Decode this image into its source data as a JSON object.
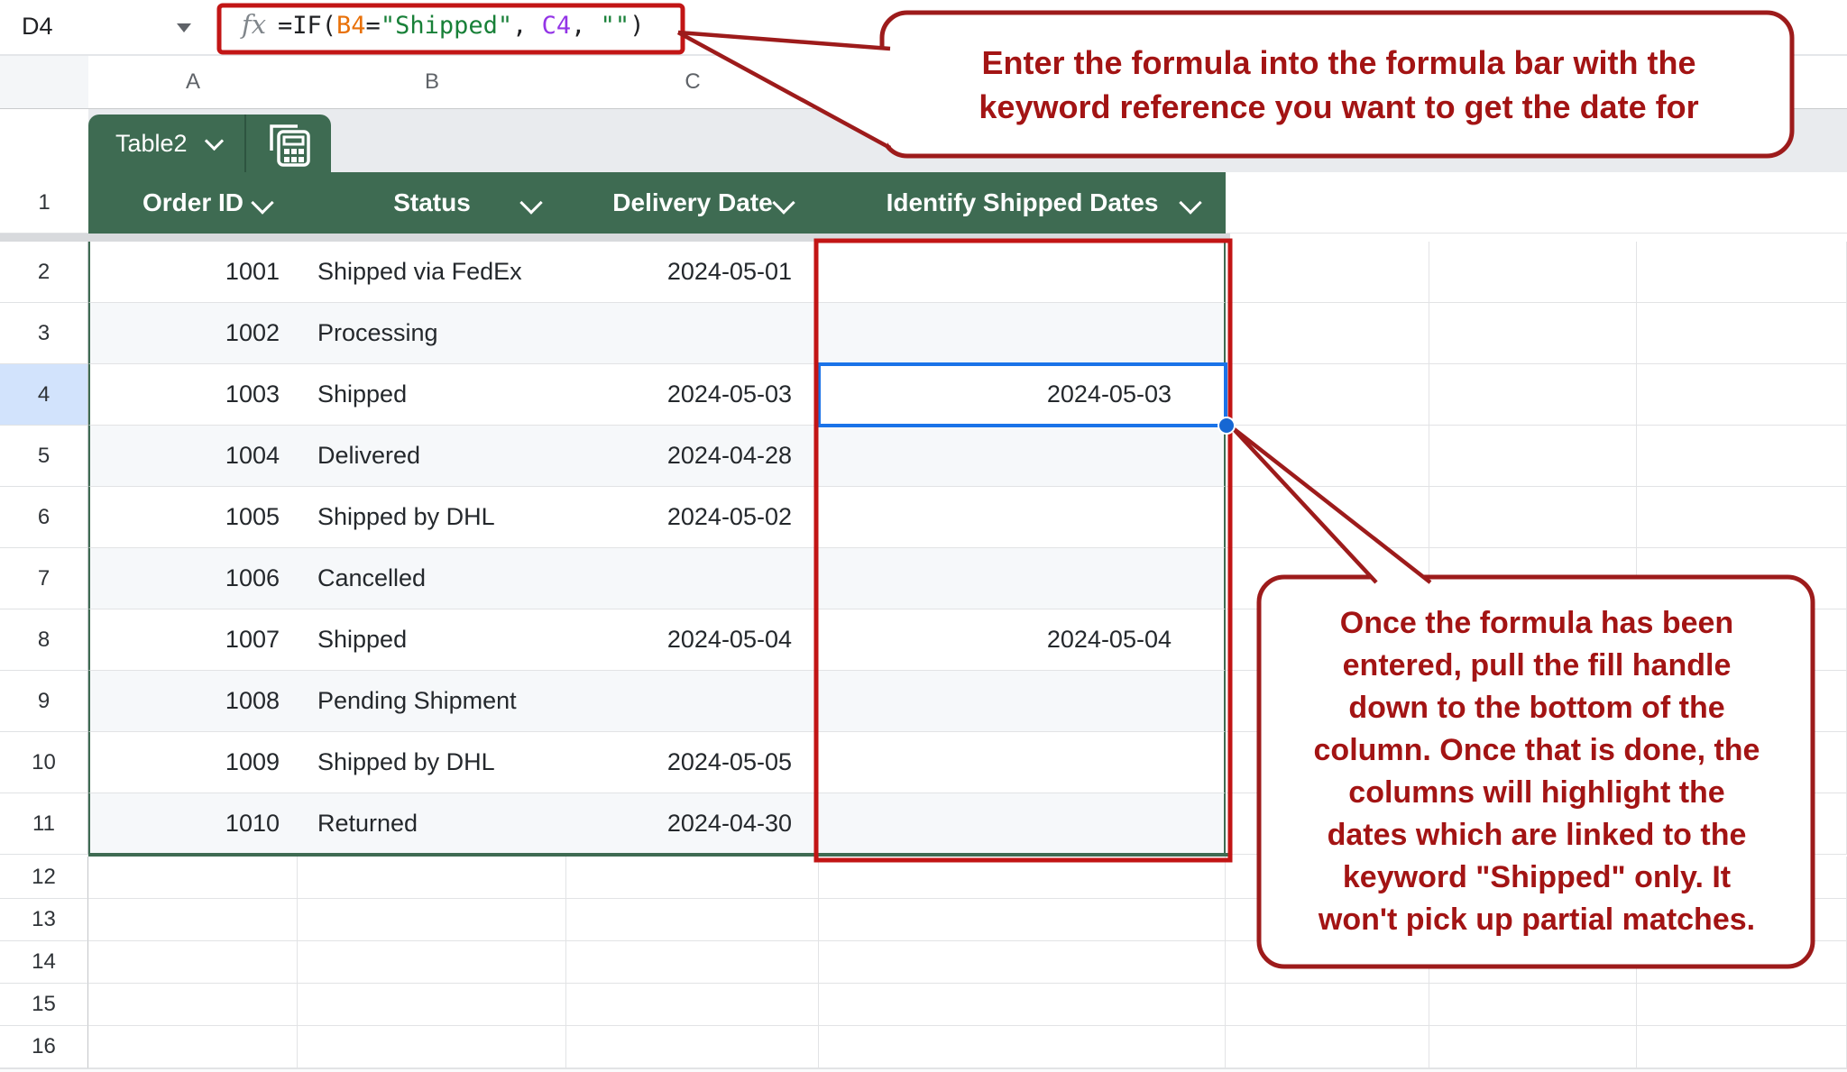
{
  "formula_bar": {
    "name_box_value": "D4",
    "fx_label": "fx",
    "formula_tokens": [
      {
        "text": "=IF(",
        "color": "#202124"
      },
      {
        "text": "B4",
        "color": "#e8710a"
      },
      {
        "text": "=",
        "color": "#202124"
      },
      {
        "text": "\"Shipped\"",
        "color": "#188038"
      },
      {
        "text": ", ",
        "color": "#202124"
      },
      {
        "text": "C4",
        "color": "#9334e6"
      },
      {
        "text": ", ",
        "color": "#202124"
      },
      {
        "text": "\"\"",
        "color": "#188038"
      },
      {
        "text": ")",
        "color": "#202124"
      }
    ]
  },
  "column_headers": {
    "letters": [
      "A",
      "B",
      "C"
    ]
  },
  "sheet": {
    "header_row_number": "1"
  },
  "table": {
    "tab_label": "Table2",
    "headers": [
      "Order ID",
      "Status",
      "Delivery Date",
      "Identify Shipped Dates"
    ],
    "rows": [
      {
        "row": "2",
        "order_id": "1001",
        "status": "Shipped via FedEx",
        "delivery_date": "2024-05-01",
        "identify_shipped_date": ""
      },
      {
        "row": "3",
        "order_id": "1002",
        "status": "Processing",
        "delivery_date": "",
        "identify_shipped_date": ""
      },
      {
        "row": "4",
        "order_id": "1003",
        "status": "Shipped",
        "delivery_date": "2024-05-03",
        "identify_shipped_date": "2024-05-03"
      },
      {
        "row": "5",
        "order_id": "1004",
        "status": "Delivered",
        "delivery_date": "2024-04-28",
        "identify_shipped_date": ""
      },
      {
        "row": "6",
        "order_id": "1005",
        "status": "Shipped by DHL",
        "delivery_date": "2024-05-02",
        "identify_shipped_date": ""
      },
      {
        "row": "7",
        "order_id": "1006",
        "status": "Cancelled",
        "delivery_date": "",
        "identify_shipped_date": ""
      },
      {
        "row": "8",
        "order_id": "1007",
        "status": "Shipped",
        "delivery_date": "2024-05-04",
        "identify_shipped_date": "2024-05-04"
      },
      {
        "row": "9",
        "order_id": "1008",
        "status": "Pending Shipment",
        "delivery_date": "",
        "identify_shipped_date": ""
      },
      {
        "row": "10",
        "order_id": "1009",
        "status": "Shipped by DHL",
        "delivery_date": "2024-05-05",
        "identify_shipped_date": ""
      },
      {
        "row": "11",
        "order_id": "1010",
        "status": "Returned",
        "delivery_date": "2024-04-30",
        "identify_shipped_date": ""
      }
    ],
    "empty_row_numbers": [
      "12",
      "13",
      "14",
      "15",
      "16"
    ]
  },
  "selection": {
    "active_cell": "D4",
    "value": "2024-05-03"
  },
  "callouts": {
    "formula_callout_lines": [
      "Enter the formula into the formula bar with the",
      "keyword reference you want to get the date for"
    ],
    "fill_callout_lines": [
      "Once the formula has been",
      "entered, pull the fill handle",
      "down to the bottom of the",
      "column. Once that is done, the",
      "columns will highlight the",
      "dates which are linked to the",
      "keyword \"Shipped\" only. It",
      "won't pick up partial matches."
    ]
  },
  "colors": {
    "table_header_green": "#3e6b52",
    "selection_blue": "#1a73e8",
    "fill_handle_blue": "#1667d3",
    "annotation_box_red": "#c21515",
    "callout_border_red": "#9d1b1b",
    "callout_text_red": "#a31414",
    "banded_row_gray": "#f6f8fa",
    "selected_header_blue": "#d2e3fc",
    "formula_ref_orange": "#e8710a",
    "formula_string_green": "#188038",
    "formula_ref_purple": "#9334e6"
  }
}
